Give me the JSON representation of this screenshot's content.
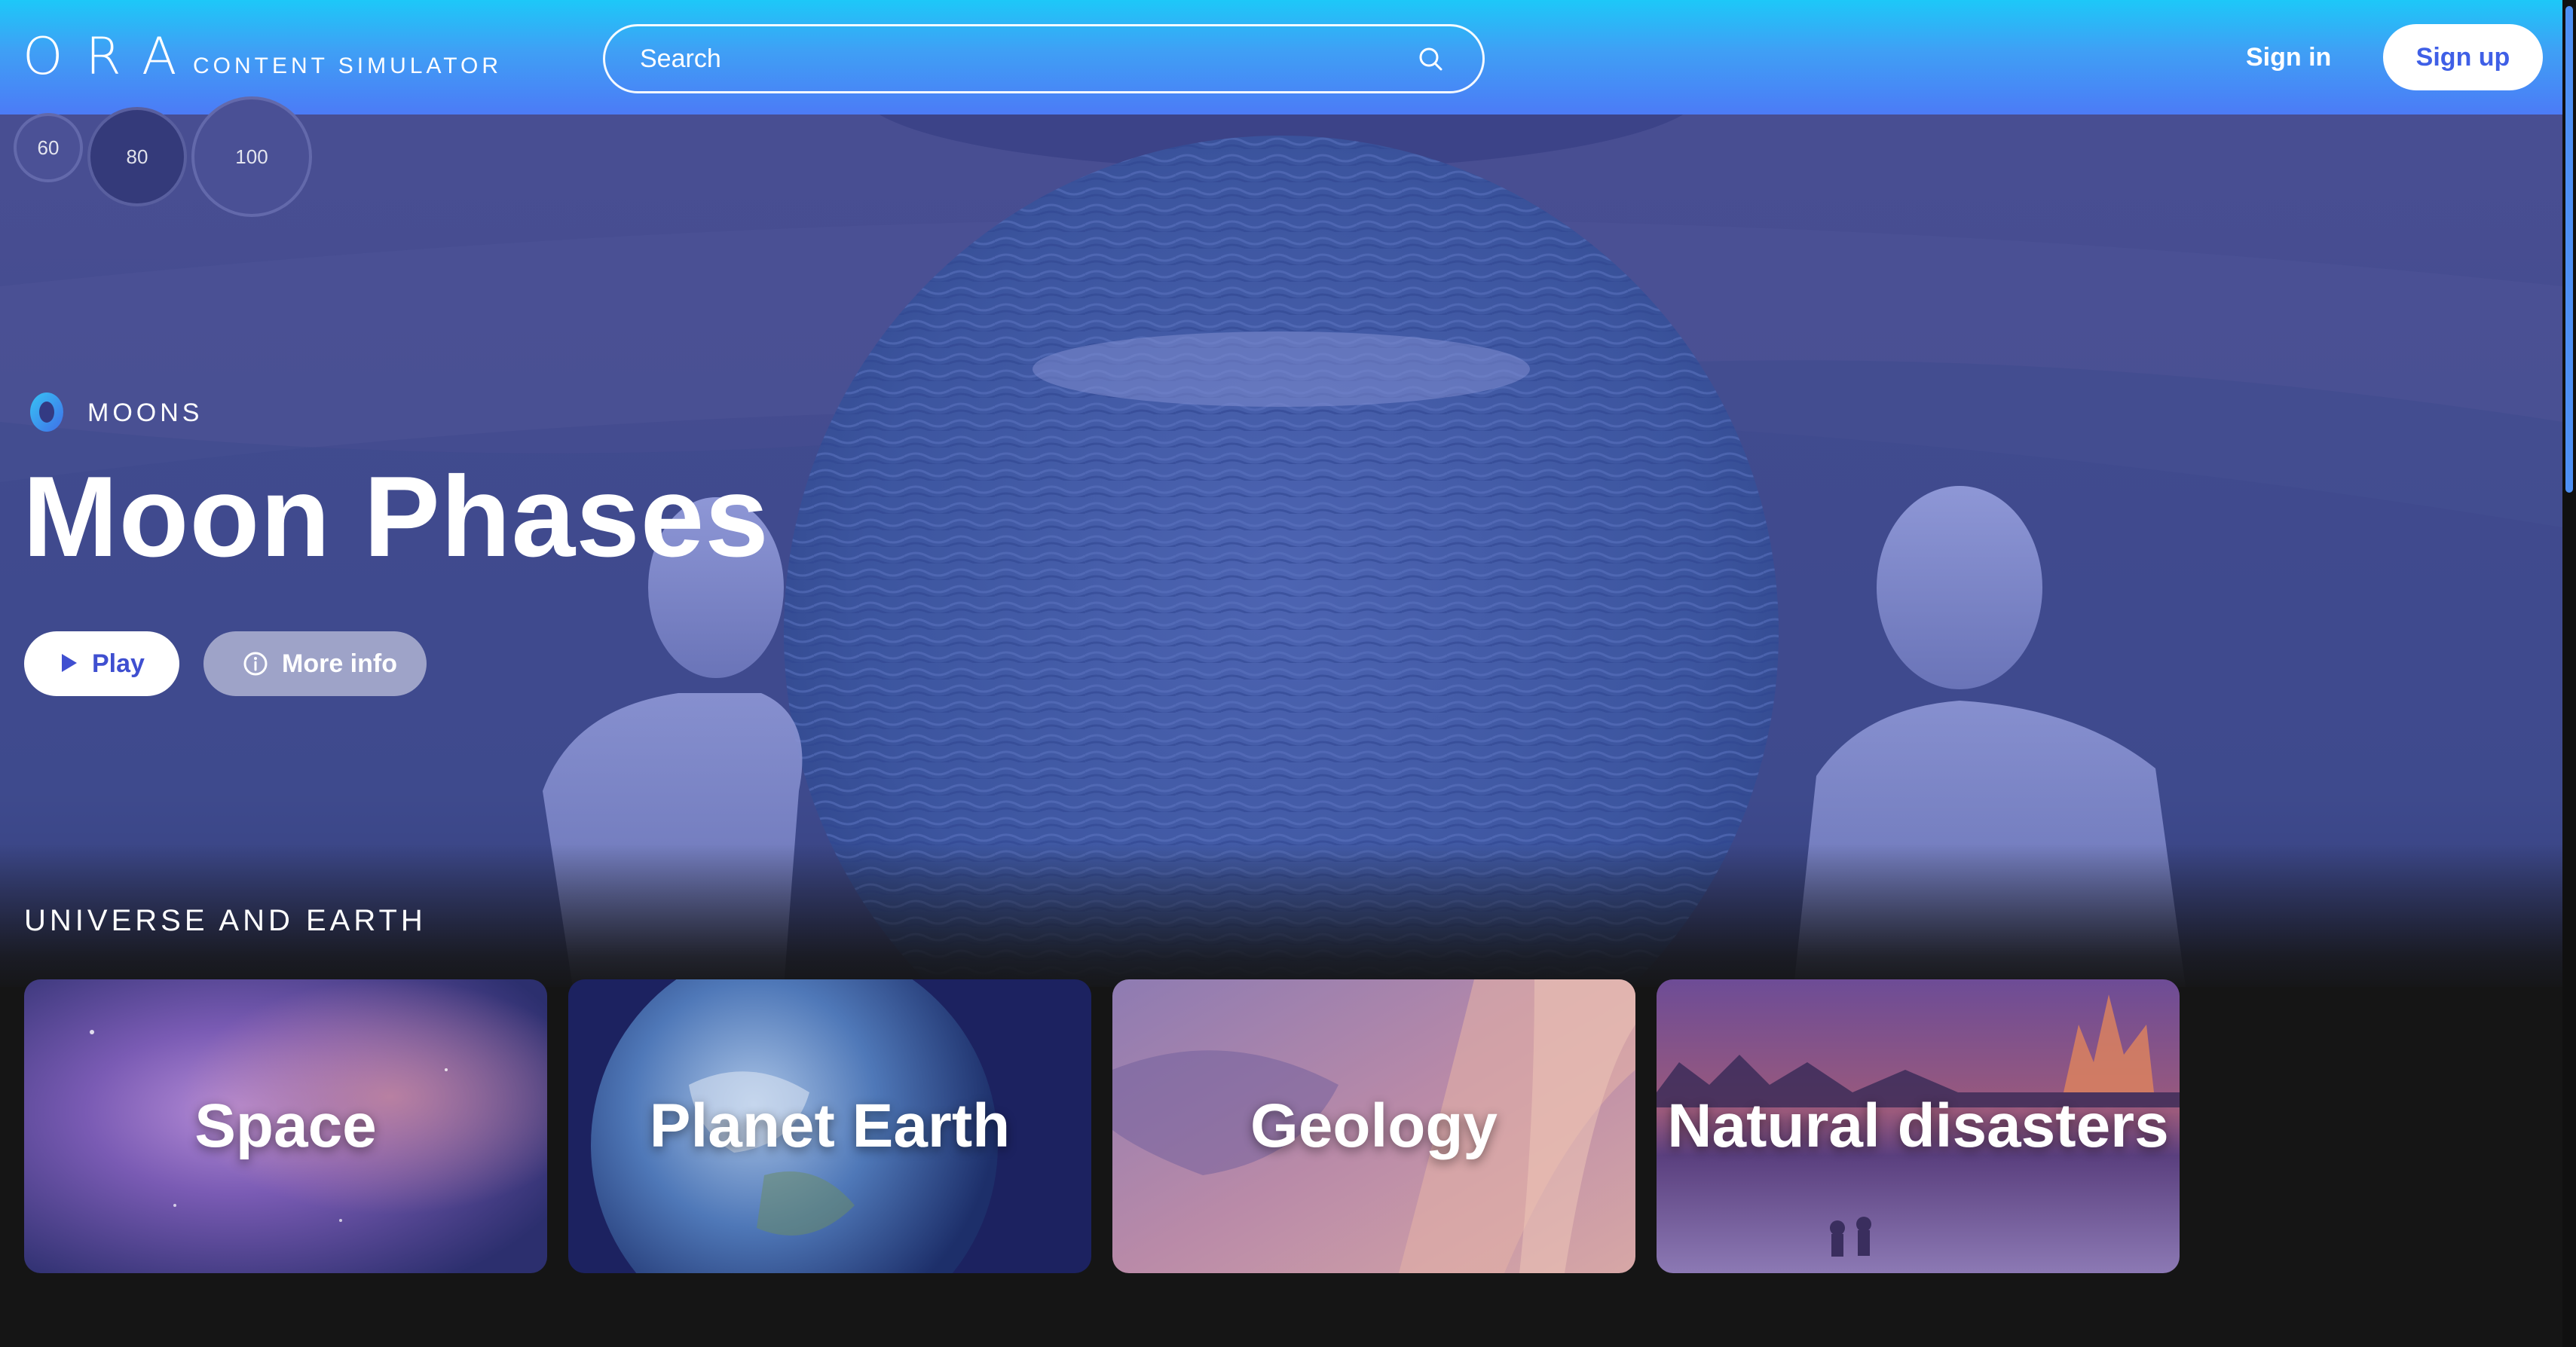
{
  "header": {
    "logo": "ORA",
    "logo_subtitle": "CONTENT SIMULATOR",
    "search_placeholder": "Search",
    "signin_label": "Sign in",
    "signup_label": "Sign up"
  },
  "quality_options": [
    "60",
    "80",
    "100"
  ],
  "hero": {
    "category": "MOONS",
    "title": "Moon Phases",
    "play_label": "Play",
    "more_info_label": "More info"
  },
  "section": {
    "title": "UNIVERSE AND EARTH",
    "cards": [
      {
        "label": "Space",
        "icon": "nebula-image"
      },
      {
        "label": "Planet Earth",
        "icon": "earth-image"
      },
      {
        "label": "Geology",
        "icon": "rock-strata-image"
      },
      {
        "label": "Natural disasters",
        "icon": "wildfire-image"
      }
    ]
  },
  "colors": {
    "header_gradient_top": "#1dc8f8",
    "header_gradient_bottom": "#4c7bf6",
    "accent": "#3f5fe6",
    "hero_tint": "#454c90",
    "background": "#151515"
  }
}
